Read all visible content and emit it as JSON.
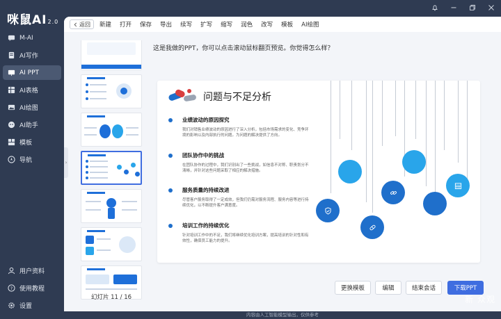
{
  "app": {
    "logo": "咪鼠AI",
    "version": "2.0"
  },
  "sidebar": {
    "items": [
      {
        "label": "M-AI",
        "icon": "chat-icon"
      },
      {
        "label": "AI写作",
        "icon": "pen-icon"
      },
      {
        "label": "AI PPT",
        "icon": "ppt-icon",
        "active": true
      },
      {
        "label": "AI表格",
        "icon": "table-icon"
      },
      {
        "label": "AI绘图",
        "icon": "image-icon"
      },
      {
        "label": "AI助手",
        "icon": "assistant-icon"
      },
      {
        "label": "模板",
        "icon": "template-icon"
      },
      {
        "label": "导航",
        "icon": "compass-icon"
      }
    ],
    "bottom": [
      {
        "label": "用户资料",
        "icon": "user-icon"
      },
      {
        "label": "使用教程",
        "icon": "help-icon"
      },
      {
        "label": "设置",
        "icon": "gear-icon"
      }
    ]
  },
  "toolbar": {
    "back": "返回",
    "tools": [
      "新建",
      "打开",
      "保存",
      "导出",
      "续写",
      "扩写",
      "缩写",
      "润色",
      "改写",
      "模板",
      "AI绘图"
    ]
  },
  "thumbs": {
    "counter": "幻灯片 11 / 16"
  },
  "message": "这是我做的PPT，你可以点击滚动鼠标翻页预览。你觉得怎么样？",
  "slide": {
    "title": "问题与不足分析",
    "items": [
      {
        "title": "业绩波动的原因探究",
        "body": "我们对销售业绩波动的原因进行了深入分析，包括市场需求的变化、竞争环境的影响以及内部执行的问题。为问题的解决提供了方向。"
      },
      {
        "title": "团队协作中的挑战",
        "body": "在团队协作的过程中，我们识别出了一些挑战，如信息不对称、职责划分不清晰，并针对这些问题采取了相应的解决措施。"
      },
      {
        "title": "服务质量的持续改进",
        "body": "尽管客户服务取得了一定成效，但我们仍需对服务流程、服务内容等进行持续优化，以不断提升客户满意度。"
      },
      {
        "title": "培训工作的持续优化",
        "body": "针对培训工作中的不足，我们将继续优化培训方案，提高培训的针对性和有效性，确保员工能力的提升。"
      }
    ]
  },
  "buttons": {
    "templates": "更换模板",
    "edit": "编辑",
    "end": "结束会话",
    "download": "下载PPT"
  },
  "footer": "内容由人工智能模型输出，仅供参考",
  "watermark": "新 众观"
}
